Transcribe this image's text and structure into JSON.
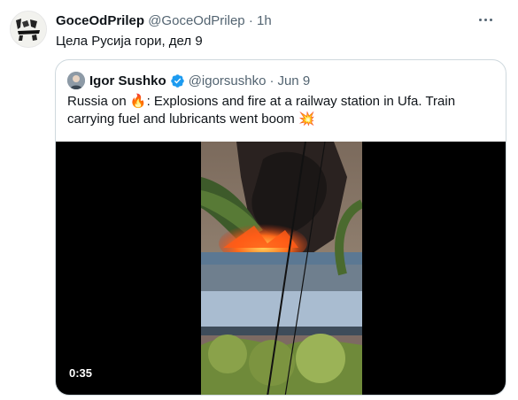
{
  "tweet": {
    "display_name": "GoceOdPrilep",
    "handle": "@GoceOdPrilep",
    "separator": "·",
    "time": "1h",
    "text": "Цела Русија гори, дел 9",
    "more_icon": "more-horizontal-icon"
  },
  "quote": {
    "display_name": "Igor Sushko",
    "handle": "@igorsushko",
    "separator": "·",
    "time": "Jun 9",
    "text_part1": "Russia on ",
    "fire_emoji": "🔥",
    "text_part2": ": Explosions and fire at a railway station in Ufa. Train carrying fuel and lubricants went boom ",
    "explosion_emoji": "💥",
    "verified_icon": "verified-badge-icon",
    "verified_color": "#1d9bf0",
    "video": {
      "duration": "0:35"
    }
  }
}
